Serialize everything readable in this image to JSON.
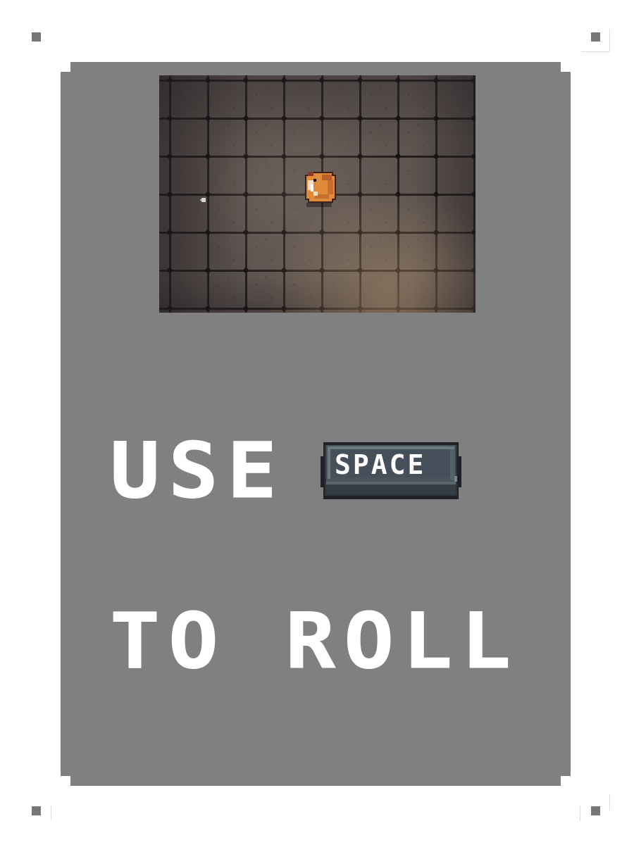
{
  "tutorial": {
    "line1_word": "USE",
    "key_label": "SPACE",
    "line2": "TO ROLL"
  },
  "game_view": {
    "floor": "stone-tile-floor",
    "player_sprite": "hamster-icon",
    "effect": "dust-puff-icon"
  },
  "colors": {
    "card": "#808080",
    "page_background": "#ffffff",
    "text": "#ffffff",
    "key_cap": "#4a545c",
    "key_outline": "#1e2226",
    "player": "#e08a3c"
  }
}
